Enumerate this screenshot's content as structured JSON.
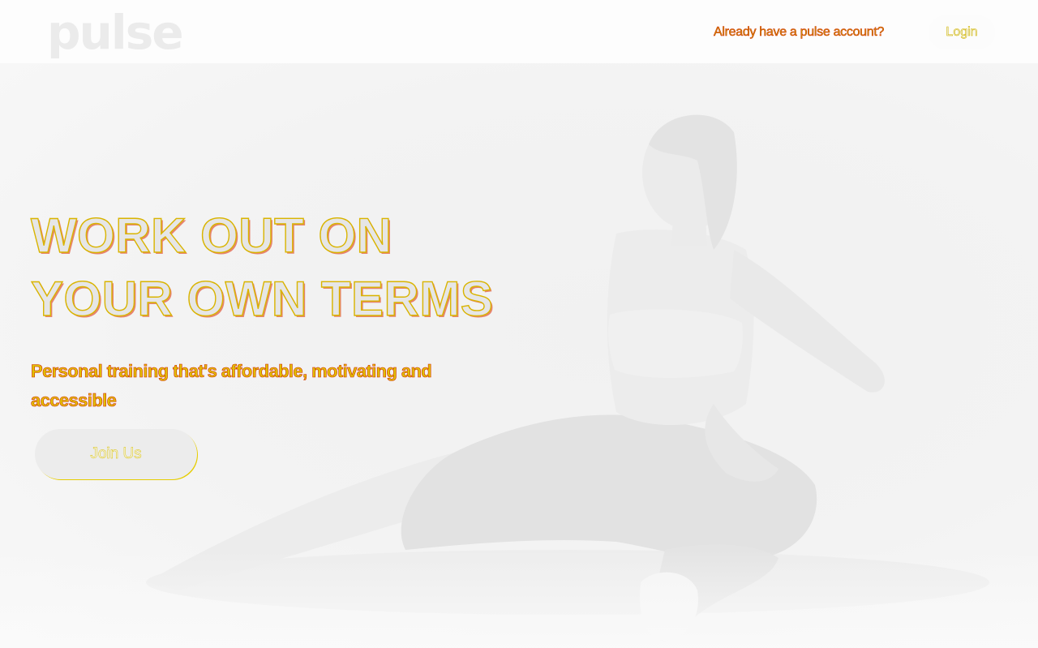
{
  "header": {
    "logo": "pulse",
    "account_prompt": "Already have a pulse account?",
    "login_label": "Login"
  },
  "hero": {
    "headline_line1": "WORK OUT ON",
    "headline_line2": "YOUR OWN TERMS",
    "tagline": "Personal training that's affordable, motivating and accessible",
    "cta_label": "Join Us",
    "image": "woman-stretching-photo"
  },
  "colors": {
    "page_background": "#f2f2f2",
    "header_background": "#fdfdfd",
    "text_fill": "#e6e6e6",
    "text_outline_yellow": "#d9b400",
    "text_outline_red": "#d62a00",
    "button_background": "#ececec"
  }
}
